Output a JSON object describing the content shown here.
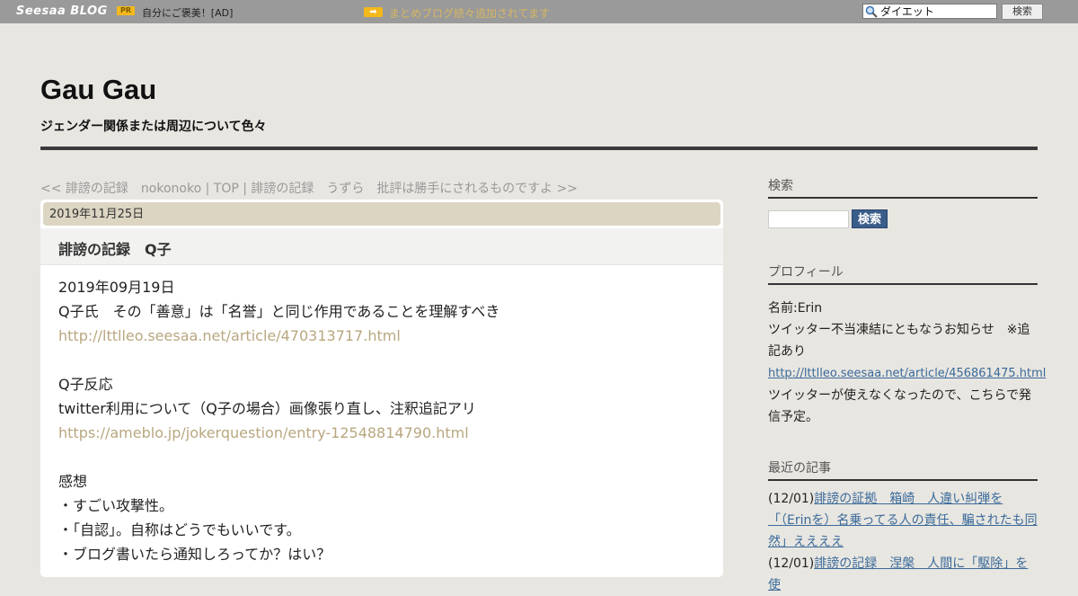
{
  "topbar": {
    "logo_text": "Seesaa BLOG",
    "pr_badge": "PR",
    "ad_text": "自分にご褒美！[AD]",
    "news_link": "まとめブログ続々追加されてます",
    "search_value": "ダイエット",
    "search_button": "検索"
  },
  "header": {
    "title": "Gau Gau",
    "description": "ジェンダー関係または周辺について色々"
  },
  "nav": {
    "prev": "<< 誹謗の記録　nokonoko",
    "sep1": " | ",
    "top": "TOP",
    "sep2": " | ",
    "next": "誹謗の記録　うずら　批評は勝手にされるものですよ >>"
  },
  "article": {
    "date": "2019年11月25日",
    "title": "誹謗の記録　Q子",
    "lines": [
      {
        "text": "2019年09月19日",
        "link": false
      },
      {
        "text": "Q子氏　その「善意」は「名誉」と同じ作用であることを理解すべき",
        "link": false
      },
      {
        "text": "http://lttlleo.seesaa.net/article/470313717.html",
        "link": true
      },
      {
        "text": "",
        "link": false
      },
      {
        "text": "Q子反応",
        "link": false
      },
      {
        "text": "twitter利用について（Q子の場合）画像張り直し、注釈追記アリ",
        "link": false
      },
      {
        "text": "https://ameblo.jp/jokerquestion/entry-12548814790.html",
        "link": true
      },
      {
        "text": "",
        "link": false
      },
      {
        "text": "感想",
        "link": false
      },
      {
        "text": "・すごい攻撃性。",
        "link": false
      },
      {
        "text": "・「自認」。自称はどうでもいいです。",
        "link": false
      },
      {
        "text": "・ブログ書いたら通知しろってか？はい？",
        "link": false
      }
    ]
  },
  "sidebar": {
    "search_heading": "検索",
    "search_button": "検索",
    "profile_heading": "プロフィール",
    "profile_name": "名前:Erin",
    "profile_text1": "ツイッター不当凍結にともなうお知らせ　※追記あり",
    "profile_link": "http://lttlleo.seesaa.net/article/456861475.html",
    "profile_text2": "ツイッターが使えなくなったので、こちらで発信予定。",
    "recent_heading": "最近の記事",
    "recent_items": [
      {
        "date": "(12/01)",
        "title": "誹謗の証拠　箱崎　人違い糾弾を「（Erinを）名乗ってる人の責任、騙されたも同然」ええええ"
      },
      {
        "date": "(12/01)",
        "title": "誹謗の記録　涅槃　人間に「駆除」を使"
      }
    ]
  }
}
